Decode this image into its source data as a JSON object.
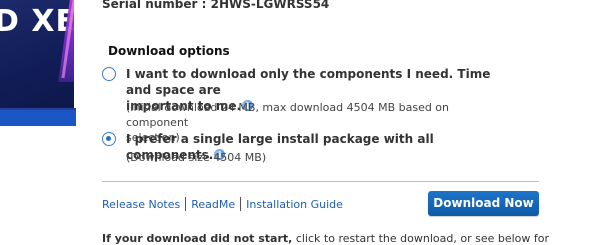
{
  "banner": {
    "brand_text": "D XE",
    "colors": {
      "background": "#101c55",
      "accent": "#1a56c4",
      "glow": "#b23bd6"
    }
  },
  "serial": "Serial number : 2HWS-LGWRSS54",
  "download_options": {
    "heading": "Download options",
    "options": [
      {
        "label_line1": "I want to download only the components I need. Time and space are",
        "label_line2": "important to me.",
        "sub_line1": "(Initial download 24 MB, max download 4504 MB based on component",
        "sub_line2": "selection)",
        "selected": false
      },
      {
        "label_line1": "I prefer a single large install package with all components.",
        "sub_line1": "(Download size 4504 MB)",
        "selected": true
      }
    ]
  },
  "links": {
    "release_notes": "Release Notes",
    "readme": "ReadMe",
    "installation_guide": "Installation Guide"
  },
  "download_button": "Download Now",
  "bottom": {
    "bold": "If your download did not start,",
    "rest": " click to restart the download, or see below for"
  },
  "colors": {
    "link": "#1f5fb3",
    "button": "#1566b8",
    "radio": "#3f7dc8"
  }
}
